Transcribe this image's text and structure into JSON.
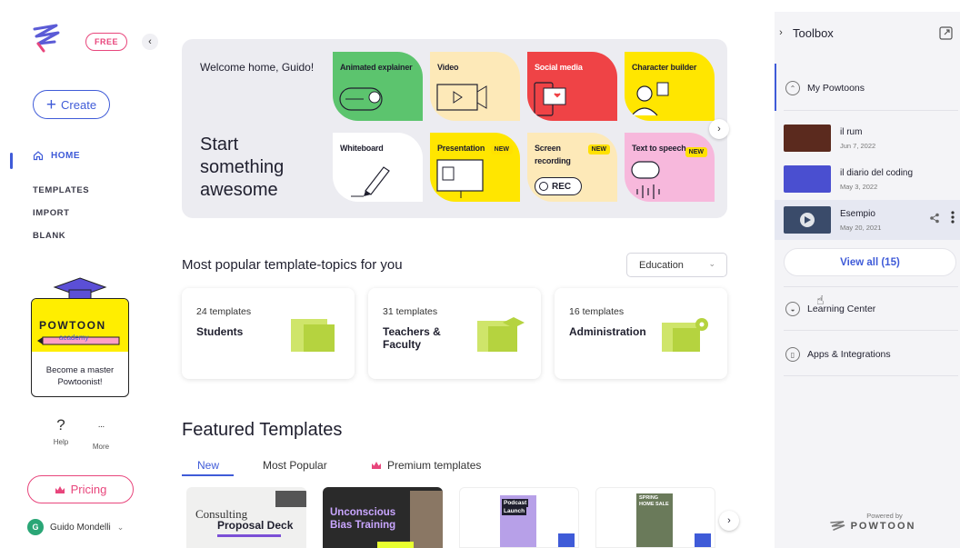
{
  "sidebar": {
    "badge": "FREE",
    "create_label": "Create",
    "nav": {
      "home": "HOME",
      "templates": "TEMPLATES",
      "import": "IMPORT",
      "blank": "BLANK"
    },
    "academy": {
      "brand": "POWTOON",
      "sub": "academy",
      "text": "Become a master Powtoonist!"
    },
    "help_label": "Help",
    "more_label": "More",
    "help_glyph": "?",
    "more_glyph": "···",
    "pricing_label": "Pricing",
    "user": {
      "initial": "G",
      "name": "Guido Mondelli"
    }
  },
  "hero": {
    "welcome": "Welcome home, Guido!",
    "title_lines": [
      "Start",
      "something",
      "awesome"
    ],
    "tiles": [
      {
        "label": "Animated explainer",
        "color": "#5cc46e"
      },
      {
        "label": "Video",
        "color": "#fde9b8"
      },
      {
        "label": "Social media",
        "color": "#ef4346"
      },
      {
        "label": "Character builder",
        "color": "#ffe600"
      },
      {
        "label": "Whiteboard",
        "color": "#ffffff"
      },
      {
        "label": "Presentation",
        "color": "#ffe600",
        "badge": "NEW"
      },
      {
        "label": "Screen recording",
        "color": "#fde9b8",
        "badge": "NEW",
        "rec": "REC"
      },
      {
        "label": "Text to speech",
        "color": "#f7b8dc",
        "badge": "NEW"
      }
    ]
  },
  "topics": {
    "title": "Most popular template-topics for you",
    "filter": "Education",
    "cards": [
      {
        "count": "24 templates",
        "name": "Students"
      },
      {
        "count": "31 templates",
        "name": "Teachers & Faculty"
      },
      {
        "count": "16 templates",
        "name": "Administration"
      }
    ]
  },
  "featured": {
    "title": "Featured Templates",
    "tabs": [
      "New",
      "Most Popular",
      "Premium templates"
    ],
    "thumbs": [
      {
        "line1": "Consulting",
        "line2": "Proposal Deck"
      },
      {
        "line1": "Unconscious",
        "line2": "Bias Training"
      },
      {
        "line1": "Podcast",
        "line2": "Launch"
      },
      {
        "line1": "SPRING",
        "line2": "HOME SALE"
      }
    ]
  },
  "toolbox": {
    "title": "Toolbox",
    "my_powtoons": "My Powtoons",
    "items": [
      {
        "name": "il rum",
        "date": "Jun 7, 2022"
      },
      {
        "name": "il diario del coding",
        "date": "May 3, 2022"
      },
      {
        "name": "Esempio",
        "date": "May 20, 2021"
      }
    ],
    "view_all": "View all (15)",
    "learning_center": "Learning Center",
    "apps": "Apps & Integrations",
    "powered_by": "Powered by",
    "powered_brand": "POWTOON"
  },
  "colors": {
    "accent": "#3f5bd8",
    "pink": "#e8467c",
    "lime": "#cfe56a"
  }
}
